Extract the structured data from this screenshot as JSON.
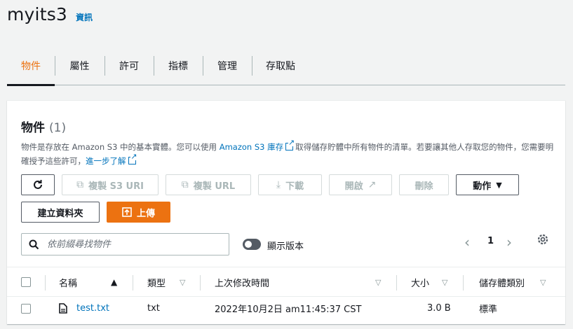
{
  "header": {
    "bucket_name": "myits3",
    "info_link": "資訊"
  },
  "tabs": [
    {
      "label": "物件"
    },
    {
      "label": "屬性"
    },
    {
      "label": "許可"
    },
    {
      "label": "指標"
    },
    {
      "label": "管理"
    },
    {
      "label": "存取點"
    }
  ],
  "objects_panel": {
    "title": "物件",
    "count": "(1)",
    "desc_part1": "物件是存放在 Amazon S3 中的基本實體。您可以使用",
    "desc_link1": "Amazon S3 庫存",
    "desc_part2": "取得儲存貯體中所有物件的清單。若要讓其他人存取您的物件，您需要明確授予這些許可，",
    "desc_link2": "進一步了解"
  },
  "toolbar": {
    "copy_s3_uri": "複製 S3 URI",
    "copy_url": "複製 URL",
    "download": "下載",
    "open": "開啟",
    "delete": "刪除",
    "actions": "動作",
    "create_folder": "建立資料夾",
    "upload": "上傳"
  },
  "search": {
    "placeholder": "依前綴尋找物件"
  },
  "versions_toggle": {
    "label": "顯示版本"
  },
  "pagination": {
    "current_page": "1"
  },
  "table": {
    "headers": {
      "name": "名稱",
      "type": "類型",
      "last_modified": "上次修改時間",
      "size": "大小",
      "storage_class": "儲存體類別"
    },
    "rows": [
      {
        "name": "test.txt",
        "type": "txt",
        "last_modified": "2022年10月2日 am11:45:37 CST",
        "size": "3.0 B",
        "storage_class": "標準"
      }
    ]
  },
  "colors": {
    "accent": "#ec7211",
    "link": "#0073bb",
    "text": "#16191f",
    "background": "#f2f3f3"
  }
}
